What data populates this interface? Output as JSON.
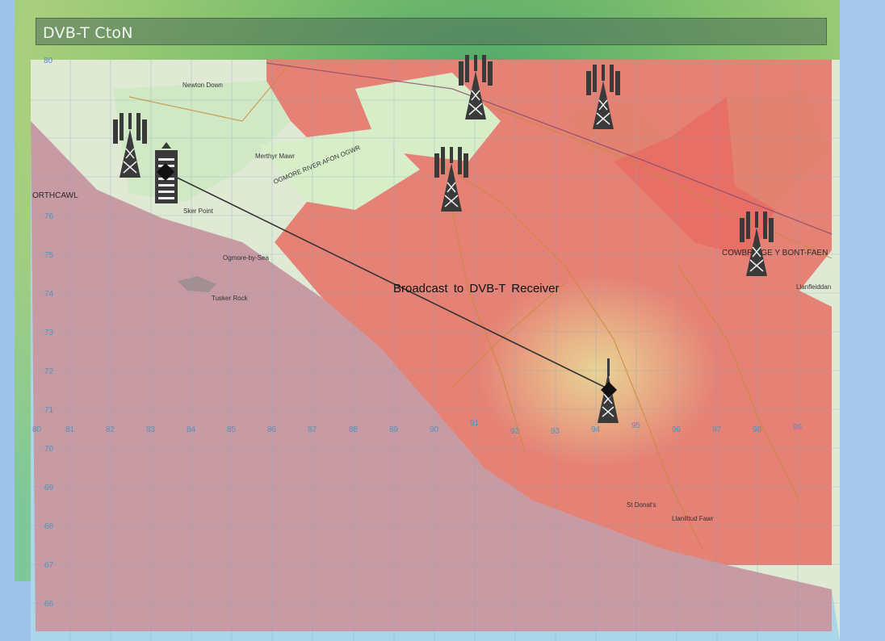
{
  "window": {
    "title": "DVB-T CtoN"
  },
  "link": {
    "label": "Broadcast  to  DVB-T Receiver"
  },
  "grid": {
    "eastings": [
      "80",
      "81",
      "82",
      "83",
      "84",
      "85",
      "86",
      "87",
      "88",
      "89",
      "90",
      "91",
      "92",
      "93",
      "94",
      "95",
      "96",
      "97",
      "98",
      "99"
    ],
    "northings": [
      "80",
      "76",
      "75",
      "74",
      "73",
      "72",
      "71",
      "70",
      "69",
      "68",
      "67",
      "66"
    ]
  },
  "places": {
    "porthcawl": "ORTHCAWL",
    "newton_down": "Newton Down",
    "ogmore_by_sea": "Ogmore-by-Sea",
    "tusker_rock": "Tusker Rock",
    "ogmore_river": "OGMORE RIVER AFON OGWR",
    "cowbridge": "COWBRIDGE Y BONT-FAEN",
    "llantwit_major": "Llanilltud Fawr",
    "st_donats": "St Donat's",
    "llanfleiddan": "Llanfleiddan",
    "sker_point": "Sker Point",
    "merthyr_mawr": "Merthyr Mawr"
  },
  "colors": {
    "coverage": "#e8645a",
    "sea": "#a9d6ea",
    "land_green": "#cde8c2",
    "terrain_green": "#5fb36a",
    "link_line": "#333333"
  },
  "icons": {
    "tower": "tower-icon",
    "receiver": "receiver-icon",
    "node": "diamond-node-icon"
  }
}
